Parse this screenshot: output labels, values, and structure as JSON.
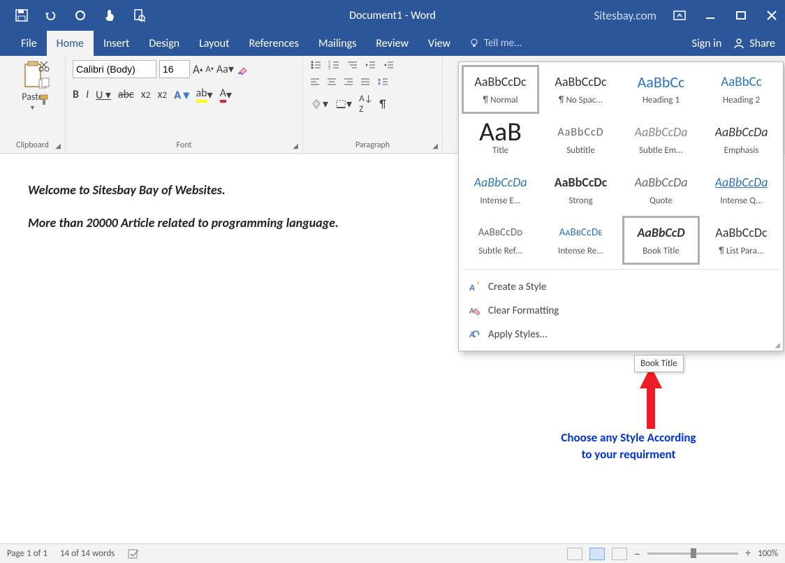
{
  "title": "Document1 - Word",
  "watermark": "Sitesbay.com",
  "tabs": [
    "File",
    "Home",
    "Insert",
    "Design",
    "Layout",
    "References",
    "Mailings",
    "Review",
    "View"
  ],
  "activeTab": 1,
  "tellme": "Tell me...",
  "signin": "Sign in",
  "share": "Share",
  "clipboard": {
    "paste": "Paste",
    "label": "Clipboard"
  },
  "font": {
    "name": "Calibri (Body)",
    "size": "16",
    "label": "Font"
  },
  "paragraph": {
    "label": "Paragraph"
  },
  "document": {
    "line1": "Welcome to Sitesbay Bay of Websites.",
    "line2": "More than 20000 Article related to programming language."
  },
  "styles": {
    "items": [
      {
        "preview": "AaBbCcDc",
        "label": "¶ Normal",
        "cls": ""
      },
      {
        "preview": "AaBbCcDc",
        "label": "¶ No Spac...",
        "cls": ""
      },
      {
        "preview": "AaBbCc",
        "label": "Heading 1",
        "cls": "h1"
      },
      {
        "preview": "AaBbCc",
        "label": "Heading 2",
        "cls": "h2"
      },
      {
        "preview": "AaB",
        "label": "Title",
        "cls": "title"
      },
      {
        "preview": "AaBbCcD",
        "label": "Subtitle",
        "cls": "sub"
      },
      {
        "preview": "AaBbCcDa",
        "label": "Subtle Em...",
        "cls": "subem"
      },
      {
        "preview": "AaBbCcDa",
        "label": "Emphasis",
        "cls": "em"
      },
      {
        "preview": "AaBbCcDa",
        "label": "Intense E...",
        "cls": "inte"
      },
      {
        "preview": "AaBbCcDc",
        "label": "Strong",
        "cls": "strong"
      },
      {
        "preview": "AaBbCcDa",
        "label": "Quote",
        "cls": "quote"
      },
      {
        "preview": "AaBbCcDa",
        "label": "Intense Q...",
        "cls": "intq"
      },
      {
        "preview": "AᴀBʙCᴄDᴅ",
        "label": "Subtle Ref...",
        "cls": "sref"
      },
      {
        "preview": "AᴀBʙCᴄDᴇ",
        "label": "Intense Re...",
        "cls": "iref"
      },
      {
        "preview": "AaBbCcD",
        "label": "Book Title",
        "cls": "book"
      },
      {
        "preview": "AaBbCcDc",
        "label": "¶ List Para...",
        "cls": ""
      }
    ],
    "create": "Create a Style",
    "clear": "Clear Formatting",
    "apply": "Apply Styles..."
  },
  "tooltip": "Book Title",
  "annotation": {
    "l1": "Choose any Style According",
    "l2": "to your requirment"
  },
  "status": {
    "page": "Page 1 of 1",
    "words": "14 of 14 words",
    "zoom": "100%"
  }
}
